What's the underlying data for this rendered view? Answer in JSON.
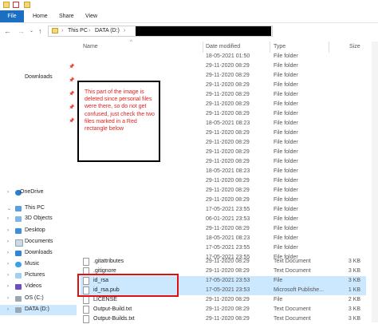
{
  "ribbon": {
    "file": "File",
    "home": "Home",
    "share": "Share",
    "view": "View"
  },
  "address": {
    "this_pc": "This PC",
    "drive": "DATA (D:)"
  },
  "nav": {
    "downloads_quick": "Downloads",
    "onedrive": "OneDrive",
    "this_pc": "This PC",
    "items": [
      "3D Objects",
      "Desktop",
      "Documents",
      "Downloads",
      "Music",
      "Pictures",
      "Videos",
      "OS (C:)",
      "DATA (D:)"
    ]
  },
  "columns": {
    "name": "Name",
    "date": "Date modified",
    "type": "Type",
    "size": "Size"
  },
  "note": "This part of the image is deleted since personal files were there, so do not get confused, just check the two files marked in a Red rectangle below",
  "folder_rows": [
    {
      "date": "18-05-2021 01:50",
      "type": "File folder"
    },
    {
      "date": "29-11-2020 08:29",
      "type": "File folder"
    },
    {
      "date": "29-11-2020 08:29",
      "type": "File folder"
    },
    {
      "date": "29-11-2020 08:29",
      "type": "File folder"
    },
    {
      "date": "29-11-2020 08:29",
      "type": "File folder"
    },
    {
      "date": "29-11-2020 08:29",
      "type": "File folder"
    },
    {
      "date": "29-11-2020 08:29",
      "type": "File folder"
    },
    {
      "date": "18-05-2021 08:23",
      "type": "File folder"
    },
    {
      "date": "29-11-2020 08:29",
      "type": "File folder"
    },
    {
      "date": "29-11-2020 08:29",
      "type": "File folder"
    },
    {
      "date": "29-11-2020 08:29",
      "type": "File folder"
    },
    {
      "date": "29-11-2020 08:29",
      "type": "File folder"
    },
    {
      "date": "18-05-2021 08:23",
      "type": "File folder"
    },
    {
      "date": "29-11-2020 08:29",
      "type": "File folder"
    },
    {
      "date": "29-11-2020 08:29",
      "type": "File folder"
    },
    {
      "date": "29-11-2020 08:29",
      "type": "File folder"
    },
    {
      "date": "17-05-2021 23:55",
      "type": "File folder"
    },
    {
      "date": "06-01-2021 23:53",
      "type": "File folder"
    },
    {
      "date": "29-11-2020 08:29",
      "type": "File folder"
    },
    {
      "date": "18-05-2021 08:23",
      "type": "File folder"
    },
    {
      "date": "17-05-2021 23:55",
      "type": "File folder"
    },
    {
      "date": "17-05-2021 23:55",
      "type": "File folder"
    }
  ],
  "file_rows": [
    {
      "name": ".gitattributes",
      "date": "29-11-2020 08:29",
      "type": "Text Document",
      "size": "3 KB"
    },
    {
      "name": ".gitignore",
      "date": "29-11-2020 08:29",
      "type": "Text Document",
      "size": "3 KB"
    },
    {
      "name": "id_rsa",
      "date": "17-05-2021 23:53",
      "type": "File",
      "size": "3 KB"
    },
    {
      "name": "id_rsa.pub",
      "date": "17-05-2021 23:53",
      "type": "Microsoft Publishe...",
      "size": "1 KB"
    },
    {
      "name": "LICENSE",
      "date": "29-11-2020 08:29",
      "type": "File",
      "size": "2 KB"
    },
    {
      "name": "Output-Build.txt",
      "date": "29-11-2020 08:29",
      "type": "Text Document",
      "size": "3 KB"
    },
    {
      "name": "Output-Builds.txt",
      "date": "29-11-2020 08:29",
      "type": "Text Document",
      "size": "3 KB"
    }
  ]
}
